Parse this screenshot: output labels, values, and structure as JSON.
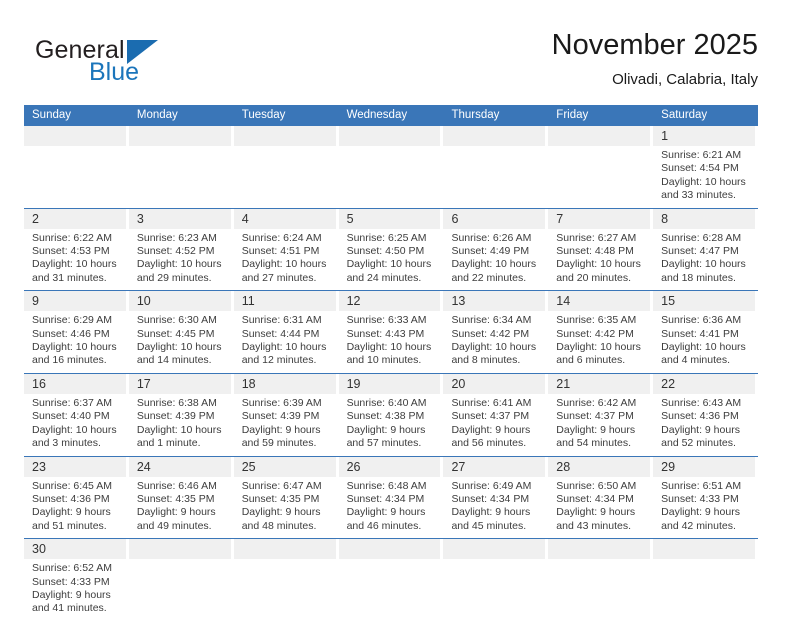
{
  "brand": {
    "name_part1": "General",
    "name_part2": "Blue",
    "accent_color": "#1b6cb0"
  },
  "header": {
    "title": "November 2025",
    "subtitle": "Olivadi, Calabria, Italy"
  },
  "calendar": {
    "header_bg": "#3a76b8",
    "daynum_bg": "#f0f0f0",
    "weekdays": [
      "Sunday",
      "Monday",
      "Tuesday",
      "Wednesday",
      "Thursday",
      "Friday",
      "Saturday"
    ],
    "weeks": [
      [
        {
          "day": "",
          "empty": true
        },
        {
          "day": "",
          "empty": true
        },
        {
          "day": "",
          "empty": true
        },
        {
          "day": "",
          "empty": true
        },
        {
          "day": "",
          "empty": true
        },
        {
          "day": "",
          "empty": true
        },
        {
          "day": "1",
          "sunrise": "Sunrise: 6:21 AM",
          "sunset": "Sunset: 4:54 PM",
          "daylight1": "Daylight: 10 hours",
          "daylight2": "and 33 minutes."
        }
      ],
      [
        {
          "day": "2",
          "sunrise": "Sunrise: 6:22 AM",
          "sunset": "Sunset: 4:53 PM",
          "daylight1": "Daylight: 10 hours",
          "daylight2": "and 31 minutes."
        },
        {
          "day": "3",
          "sunrise": "Sunrise: 6:23 AM",
          "sunset": "Sunset: 4:52 PM",
          "daylight1": "Daylight: 10 hours",
          "daylight2": "and 29 minutes."
        },
        {
          "day": "4",
          "sunrise": "Sunrise: 6:24 AM",
          "sunset": "Sunset: 4:51 PM",
          "daylight1": "Daylight: 10 hours",
          "daylight2": "and 27 minutes."
        },
        {
          "day": "5",
          "sunrise": "Sunrise: 6:25 AM",
          "sunset": "Sunset: 4:50 PM",
          "daylight1": "Daylight: 10 hours",
          "daylight2": "and 24 minutes."
        },
        {
          "day": "6",
          "sunrise": "Sunrise: 6:26 AM",
          "sunset": "Sunset: 4:49 PM",
          "daylight1": "Daylight: 10 hours",
          "daylight2": "and 22 minutes."
        },
        {
          "day": "7",
          "sunrise": "Sunrise: 6:27 AM",
          "sunset": "Sunset: 4:48 PM",
          "daylight1": "Daylight: 10 hours",
          "daylight2": "and 20 minutes."
        },
        {
          "day": "8",
          "sunrise": "Sunrise: 6:28 AM",
          "sunset": "Sunset: 4:47 PM",
          "daylight1": "Daylight: 10 hours",
          "daylight2": "and 18 minutes."
        }
      ],
      [
        {
          "day": "9",
          "sunrise": "Sunrise: 6:29 AM",
          "sunset": "Sunset: 4:46 PM",
          "daylight1": "Daylight: 10 hours",
          "daylight2": "and 16 minutes."
        },
        {
          "day": "10",
          "sunrise": "Sunrise: 6:30 AM",
          "sunset": "Sunset: 4:45 PM",
          "daylight1": "Daylight: 10 hours",
          "daylight2": "and 14 minutes."
        },
        {
          "day": "11",
          "sunrise": "Sunrise: 6:31 AM",
          "sunset": "Sunset: 4:44 PM",
          "daylight1": "Daylight: 10 hours",
          "daylight2": "and 12 minutes."
        },
        {
          "day": "12",
          "sunrise": "Sunrise: 6:33 AM",
          "sunset": "Sunset: 4:43 PM",
          "daylight1": "Daylight: 10 hours",
          "daylight2": "and 10 minutes."
        },
        {
          "day": "13",
          "sunrise": "Sunrise: 6:34 AM",
          "sunset": "Sunset: 4:42 PM",
          "daylight1": "Daylight: 10 hours",
          "daylight2": "and 8 minutes."
        },
        {
          "day": "14",
          "sunrise": "Sunrise: 6:35 AM",
          "sunset": "Sunset: 4:42 PM",
          "daylight1": "Daylight: 10 hours",
          "daylight2": "and 6 minutes."
        },
        {
          "day": "15",
          "sunrise": "Sunrise: 6:36 AM",
          "sunset": "Sunset: 4:41 PM",
          "daylight1": "Daylight: 10 hours",
          "daylight2": "and 4 minutes."
        }
      ],
      [
        {
          "day": "16",
          "sunrise": "Sunrise: 6:37 AM",
          "sunset": "Sunset: 4:40 PM",
          "daylight1": "Daylight: 10 hours",
          "daylight2": "and 3 minutes."
        },
        {
          "day": "17",
          "sunrise": "Sunrise: 6:38 AM",
          "sunset": "Sunset: 4:39 PM",
          "daylight1": "Daylight: 10 hours",
          "daylight2": "and 1 minute."
        },
        {
          "day": "18",
          "sunrise": "Sunrise: 6:39 AM",
          "sunset": "Sunset: 4:39 PM",
          "daylight1": "Daylight: 9 hours",
          "daylight2": "and 59 minutes."
        },
        {
          "day": "19",
          "sunrise": "Sunrise: 6:40 AM",
          "sunset": "Sunset: 4:38 PM",
          "daylight1": "Daylight: 9 hours",
          "daylight2": "and 57 minutes."
        },
        {
          "day": "20",
          "sunrise": "Sunrise: 6:41 AM",
          "sunset": "Sunset: 4:37 PM",
          "daylight1": "Daylight: 9 hours",
          "daylight2": "and 56 minutes."
        },
        {
          "day": "21",
          "sunrise": "Sunrise: 6:42 AM",
          "sunset": "Sunset: 4:37 PM",
          "daylight1": "Daylight: 9 hours",
          "daylight2": "and 54 minutes."
        },
        {
          "day": "22",
          "sunrise": "Sunrise: 6:43 AM",
          "sunset": "Sunset: 4:36 PM",
          "daylight1": "Daylight: 9 hours",
          "daylight2": "and 52 minutes."
        }
      ],
      [
        {
          "day": "23",
          "sunrise": "Sunrise: 6:45 AM",
          "sunset": "Sunset: 4:36 PM",
          "daylight1": "Daylight: 9 hours",
          "daylight2": "and 51 minutes."
        },
        {
          "day": "24",
          "sunrise": "Sunrise: 6:46 AM",
          "sunset": "Sunset: 4:35 PM",
          "daylight1": "Daylight: 9 hours",
          "daylight2": "and 49 minutes."
        },
        {
          "day": "25",
          "sunrise": "Sunrise: 6:47 AM",
          "sunset": "Sunset: 4:35 PM",
          "daylight1": "Daylight: 9 hours",
          "daylight2": "and 48 minutes."
        },
        {
          "day": "26",
          "sunrise": "Sunrise: 6:48 AM",
          "sunset": "Sunset: 4:34 PM",
          "daylight1": "Daylight: 9 hours",
          "daylight2": "and 46 minutes."
        },
        {
          "day": "27",
          "sunrise": "Sunrise: 6:49 AM",
          "sunset": "Sunset: 4:34 PM",
          "daylight1": "Daylight: 9 hours",
          "daylight2": "and 45 minutes."
        },
        {
          "day": "28",
          "sunrise": "Sunrise: 6:50 AM",
          "sunset": "Sunset: 4:34 PM",
          "daylight1": "Daylight: 9 hours",
          "daylight2": "and 43 minutes."
        },
        {
          "day": "29",
          "sunrise": "Sunrise: 6:51 AM",
          "sunset": "Sunset: 4:33 PM",
          "daylight1": "Daylight: 9 hours",
          "daylight2": "and 42 minutes."
        }
      ],
      [
        {
          "day": "30",
          "sunrise": "Sunrise: 6:52 AM",
          "sunset": "Sunset: 4:33 PM",
          "daylight1": "Daylight: 9 hours",
          "daylight2": "and 41 minutes."
        },
        {
          "day": "",
          "empty": true
        },
        {
          "day": "",
          "empty": true
        },
        {
          "day": "",
          "empty": true
        },
        {
          "day": "",
          "empty": true
        },
        {
          "day": "",
          "empty": true
        },
        {
          "day": "",
          "empty": true
        }
      ]
    ]
  }
}
